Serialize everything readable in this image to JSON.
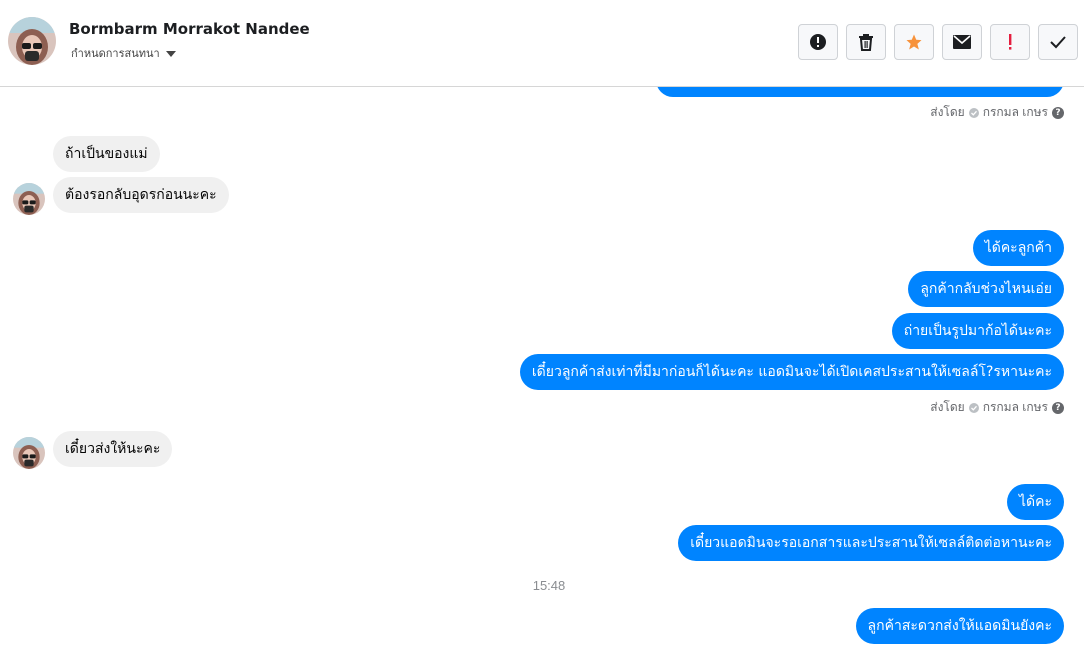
{
  "header": {
    "contact_name": "Bormbarm Morrakot Nandee",
    "assign_label": "กำหนดการสนทนา",
    "toolbar": [
      {
        "icon": "alert-circle-icon",
        "action": "report"
      },
      {
        "icon": "trash-icon",
        "action": "delete"
      },
      {
        "icon": "star-icon",
        "action": "star",
        "color": "#f7923b"
      },
      {
        "icon": "envelope-icon",
        "action": "mark-unread"
      },
      {
        "icon": "exclamation-icon",
        "action": "mark-spam",
        "color": "#e41e3f"
      },
      {
        "icon": "check-icon",
        "action": "mark-done"
      }
    ]
  },
  "messages": {
    "sent_by_1": {
      "prefix": "ส่งโดย",
      "name": "กรกมล เกษร"
    },
    "in_1": "ถ้าเป็นของแม่",
    "in_2": "ต้องรอกลับอุดรก่อนนะคะ",
    "out_1": "ได้คะลูกค้า",
    "out_2": "ลูกค้ากลับช่วงไหนเอ่ย",
    "out_3": "ถ่ายเป็นรูปมาก้อได้นะคะ",
    "out_4": "เดี๋ยวลูกค้าส่งเท่าที่มีมาก่อนก็ได้นะคะ แอดมินจะได้เปิดเคสประสานให้เซลล์โ?รหานะคะ",
    "sent_by_2": {
      "prefix": "ส่งโดย",
      "name": "กรกมล เกษร"
    },
    "in_3": "เดี๋ยวส่งให้นะคะ",
    "out_5": "ได้คะ",
    "out_6": "เดี๋ยวแอดมินจะรอเอกสารและประสานให้เซลล์ติดต่อหานะคะ",
    "timestamp": "15:48",
    "out_7": "ลูกค้าสะดวกส่งให้แอดมินยังคะ"
  },
  "colors": {
    "outgoing_bubble": "#0084ff",
    "incoming_bubble": "#f0f0f0"
  }
}
